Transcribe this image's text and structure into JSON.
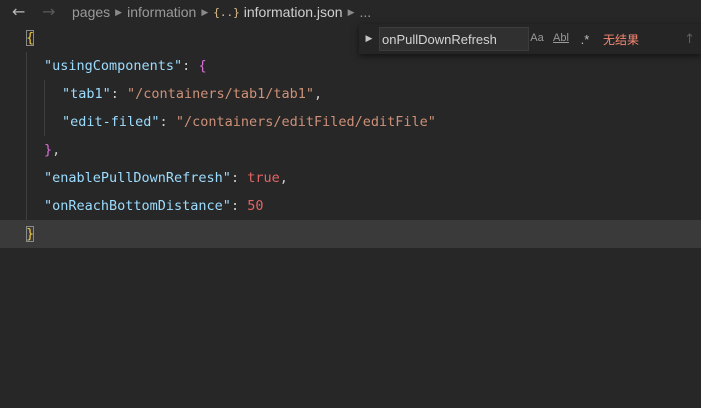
{
  "breadcrumb": {
    "back_icon": "arrow-left-icon",
    "forward_icon": "arrow-right-icon",
    "items": [
      "pages",
      "information"
    ],
    "file_icon": "{..}",
    "file": "information.json",
    "more": "..."
  },
  "find": {
    "query": "onPullDownRefresh",
    "match_case": "Aa",
    "whole_word": "Abl",
    "regex": ".*",
    "result": "无结果",
    "up_icon": "arrow-up-icon"
  },
  "code": {
    "l1": "{",
    "l2_key": "\"usingComponents\"",
    "l2_colon": ": ",
    "l2_brace": "{",
    "l3_key": "\"tab1\"",
    "l3_colon": ": ",
    "l3_val": "\"/containers/tab1/tab1\"",
    "l3_comma": ",",
    "l4_key": "\"edit-filed\"",
    "l4_colon": ": ",
    "l4_val": "\"/containers/editFiled/editFile\"",
    "l5_brace": "}",
    "l5_comma": ",",
    "l6_key": "\"enablePullDownRefresh\"",
    "l6_colon": ": ",
    "l6_val": "true",
    "l6_comma": ",",
    "l7_key": "\"onReachBottomDistance\"",
    "l7_colon": ": ",
    "l7_val": "50",
    "l8": "}"
  },
  "colors": {
    "background": "#272727",
    "string": "#ce9178",
    "key": "#9cdcfe",
    "literal": "#e26464",
    "brace": "#f0c940",
    "nested_brace": "#d970d6",
    "no_results": "#f48771"
  }
}
